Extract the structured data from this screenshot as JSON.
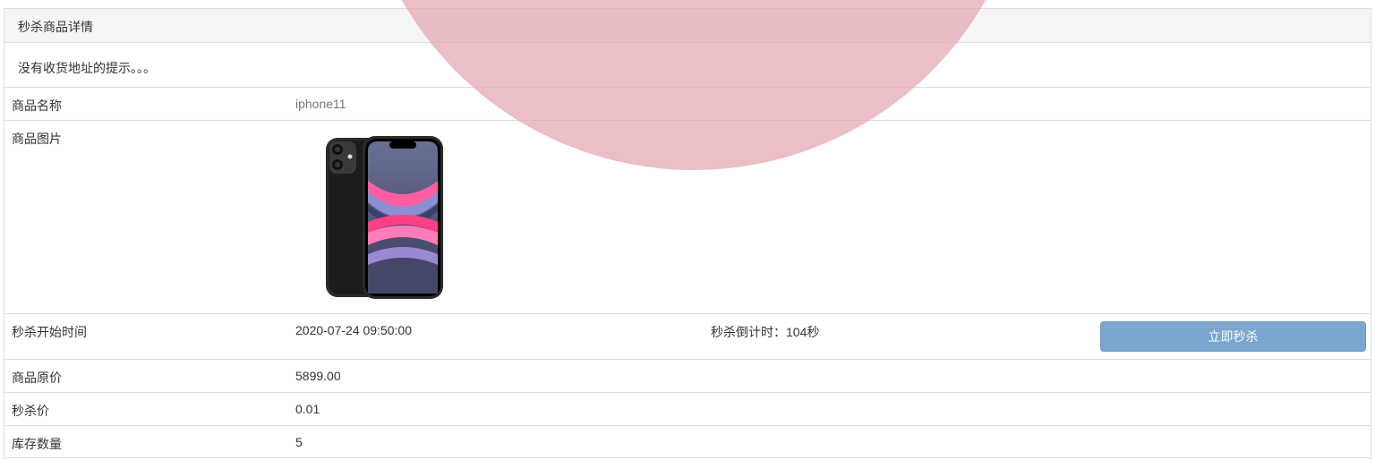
{
  "panel": {
    "heading": "秒杀商品详情",
    "notice": "没有收货地址的提示。。。"
  },
  "rows": {
    "name": {
      "label": "商品名称",
      "value": "iphone11"
    },
    "image": {
      "label": "商品图片",
      "icon": "phone-product-image"
    },
    "start": {
      "label": "秒杀开始时间",
      "value": "2020-07-24 09:50:00",
      "countdown": "秒杀倒计时：104秒",
      "button": "立即秒杀"
    },
    "price": {
      "label": "商品原价",
      "value": "5899.00"
    },
    "seckill": {
      "label": "秒杀价",
      "value": "0.01"
    },
    "stock": {
      "label": "库存数量",
      "value": "5"
    }
  },
  "colors": {
    "button_bg": "#7aa6cf",
    "overlay_pink": "#e4a5b0",
    "border": "#dddddd",
    "heading_bg": "#f5f5f5"
  }
}
